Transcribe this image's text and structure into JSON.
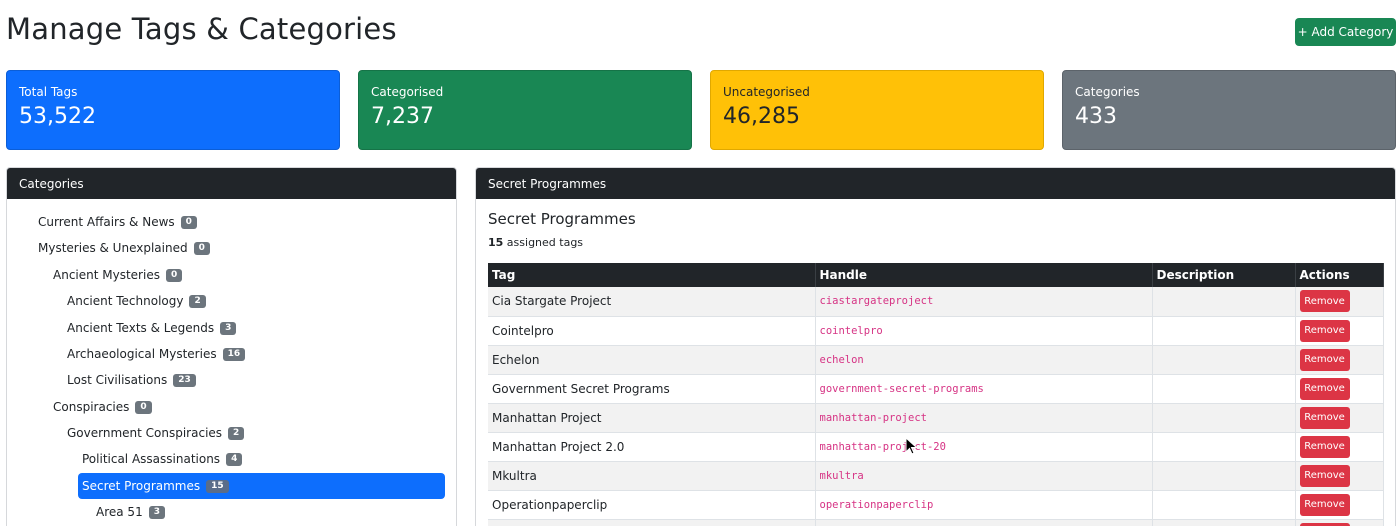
{
  "header": {
    "title": "Manage Tags & Categories",
    "add_label": "+ Add Category"
  },
  "stats": [
    {
      "label": "Total Tags",
      "value": "53,522"
    },
    {
      "label": "Categorised",
      "value": "7,237"
    },
    {
      "label": "Uncategorised",
      "value": "46,285"
    },
    {
      "label": "Categories",
      "value": "433"
    }
  ],
  "categories_panel": {
    "title": "Categories",
    "items": [
      {
        "label": "Current Affairs & News",
        "count": "0"
      },
      {
        "label": "Mysteries & Unexplained",
        "count": "0"
      },
      {
        "label": "Ancient Mysteries",
        "count": "0"
      },
      {
        "label": "Ancient Technology",
        "count": "2"
      },
      {
        "label": "Ancient Texts & Legends",
        "count": "3"
      },
      {
        "label": "Archaeological Mysteries",
        "count": "16"
      },
      {
        "label": "Lost Civilisations",
        "count": "23"
      },
      {
        "label": "Conspiracies",
        "count": "0"
      },
      {
        "label": "Government Conspiracies",
        "count": "2"
      },
      {
        "label": "Political Assassinations",
        "count": "4"
      },
      {
        "label": "Secret Programmes",
        "count": "15"
      },
      {
        "label": "Area 51",
        "count": "3"
      }
    ]
  },
  "detail": {
    "header": "Secret Programmes",
    "title": "Secret Programmes",
    "count": "15",
    "count_suffix": " assigned tags",
    "columns": [
      "Tag",
      "Handle",
      "Description",
      "Actions"
    ],
    "remove_label": "Remove",
    "rows": [
      {
        "tag": "Cia Stargate Project",
        "handle": "ciastargateproject",
        "description": ""
      },
      {
        "tag": "Cointelpro",
        "handle": "cointelpro",
        "description": ""
      },
      {
        "tag": "Echelon",
        "handle": "echelon",
        "description": ""
      },
      {
        "tag": "Government Secret Programs",
        "handle": "government-secret-programs",
        "description": ""
      },
      {
        "tag": "Manhattan Project",
        "handle": "manhattan-project",
        "description": ""
      },
      {
        "tag": "Manhattan Project 2.0",
        "handle": "manhattan-project-20",
        "description": ""
      },
      {
        "tag": "Mkultra",
        "handle": "mkultra",
        "description": ""
      },
      {
        "tag": "Operationpaperclip",
        "handle": "operationpaperclip",
        "description": ""
      }
    ]
  },
  "colors": {
    "primary": "#0d6efd",
    "success": "#198754",
    "warning": "#ffc107",
    "secondary": "#6c757d",
    "danger": "#dc3545",
    "dark": "#212529",
    "handle": "#d63384"
  },
  "icons": {
    "cursor": "mouse-pointer-icon"
  }
}
